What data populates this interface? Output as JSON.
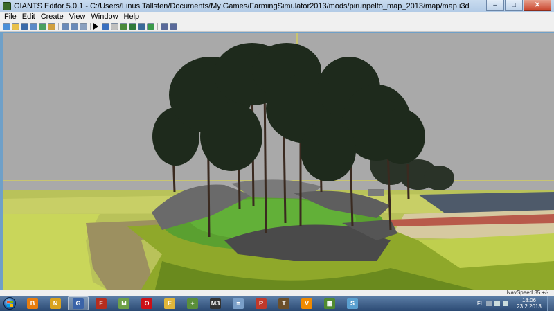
{
  "window": {
    "title": "GIANTS Editor 5.0.1 - C:/Users/Linus Tallsten/Documents/My Games/FarmingSimulator2013/mods/pirunpelto_map_2013/map/map.i3d",
    "controls": {
      "minimize": "–",
      "maximize": "□",
      "close": "✕"
    }
  },
  "menu": {
    "items": [
      "File",
      "Edit",
      "Create",
      "View",
      "Window",
      "Help"
    ]
  },
  "toolbar": {
    "groups": [
      [
        "new-file-icon",
        "open-file-icon",
        "save-file-icon",
        "save-as-icon",
        "export-icon",
        "import-icon"
      ],
      [
        "undo-icon",
        "redo-icon",
        "refresh-icon"
      ],
      [
        "play-icon"
      ],
      [
        "select-mode-icon",
        "move-tool-icon",
        "terrain-sculpt-icon",
        "terrain-paint-icon",
        "foliage-paint-icon",
        "grass-paint-icon"
      ],
      [
        "settings-icon",
        "scripts-icon"
      ]
    ]
  },
  "viewport": {
    "sky_color": "#a9a9a9",
    "grass_color": "#c9d65a",
    "terrain_color": "#7cb342",
    "rock_color": "#5b5b5b"
  },
  "status": {
    "navspeed": "NavSpeed 35 +/-"
  },
  "taskbar": {
    "apps": [
      {
        "name": "blender-app-icon",
        "color": "#e87d0d",
        "glyph": "B"
      },
      {
        "name": "notepad-app-icon",
        "color": "#d9a21e",
        "glyph": "N"
      },
      {
        "name": "giants-editor-app-icon",
        "color": "#3a63a8",
        "glyph": "G"
      },
      {
        "name": "farming-simulator-app-icon",
        "color": "#b52d1e",
        "glyph": "F"
      },
      {
        "name": "map-viewer-app-icon",
        "color": "#6ea048",
        "glyph": "M"
      },
      {
        "name": "opera-app-icon",
        "color": "#cc0f16",
        "glyph": "O"
      },
      {
        "name": "file-explorer-app-icon",
        "color": "#e0b63a",
        "glyph": "E"
      },
      {
        "name": "notepad-plus-app-icon",
        "color": "#5a8f3a",
        "glyph": "+"
      },
      {
        "name": "media-tool-app-icon",
        "color": "#333333",
        "glyph": "M3"
      },
      {
        "name": "calculator-app-icon",
        "color": "#7a9fc9",
        "glyph": "="
      },
      {
        "name": "paint-app-icon",
        "color": "#c0392b",
        "glyph": "P"
      },
      {
        "name": "texture-tool-app-icon",
        "color": "#6b4f2a",
        "glyph": "T"
      },
      {
        "name": "vlc-app-icon",
        "color": "#f08a00",
        "glyph": "V"
      },
      {
        "name": "minecraft-app-icon",
        "color": "#4f8a2f",
        "glyph": "▦"
      },
      {
        "name": "sketch-app-icon",
        "color": "#5aa0d0",
        "glyph": "S"
      }
    ],
    "active_app": "giants-editor-app-icon",
    "tray": {
      "lang": "FI",
      "time": "18:06",
      "date": "23.2.2013"
    }
  }
}
